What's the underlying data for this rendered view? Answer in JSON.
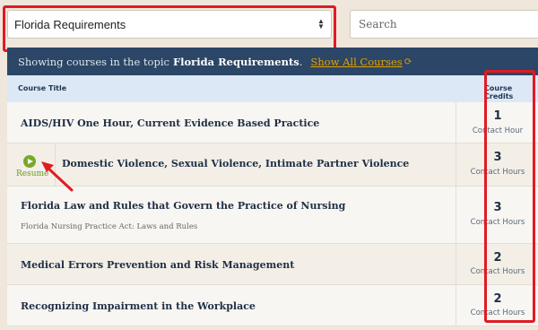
{
  "topic_select": {
    "value": "Florida Requirements"
  },
  "search": {
    "placeholder": "Search"
  },
  "banner": {
    "prefix": "Showing courses in the topic",
    "topic": "Florida Requirements",
    "period": ".",
    "show_all_label": "Show All Courses"
  },
  "table": {
    "headers": {
      "title": "Course Title",
      "credits": "Course Credits"
    },
    "rows": [
      {
        "title": "AIDS/HIV One Hour, Current Evidence Based Practice",
        "subtitle": "",
        "credits": "1",
        "unit": "Contact Hour"
      },
      {
        "title": "Domestic Violence, Sexual Violence, Intimate Partner Violence",
        "subtitle": "",
        "credits": "3",
        "unit": "Contact Hours",
        "resume_label": "Resume"
      },
      {
        "title": "Florida Law and Rules that Govern the Practice of Nursing",
        "subtitle": "Florida Nursing Practice Act: Laws and Rules",
        "credits": "3",
        "unit": "Contact Hours"
      },
      {
        "title": "Medical Errors Prevention and Risk Management",
        "subtitle": "",
        "credits": "2",
        "unit": "Contact Hours"
      },
      {
        "title": "Recognizing Impairment in the Workplace",
        "subtitle": "",
        "credits": "2",
        "unit": "Contact Hours"
      }
    ]
  },
  "colors": {
    "banner_bg": "#2b4666",
    "header_bg": "#dce8f5",
    "accent_link": "#e5a100",
    "annotation_red": "#e01b24",
    "resume_green": "#7aa82a"
  },
  "icons": [
    "chevron-updown-icon",
    "refresh-icon",
    "play-icon",
    "annotation-arrow"
  ]
}
